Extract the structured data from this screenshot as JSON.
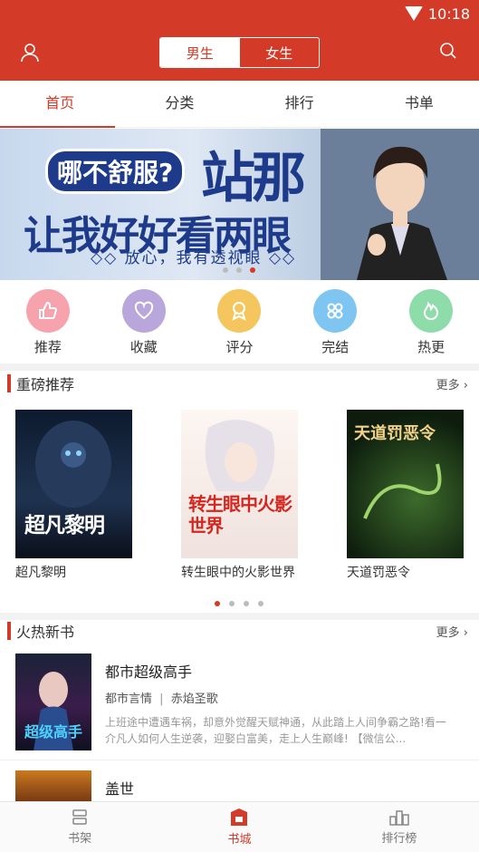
{
  "status": {
    "time": "10:18"
  },
  "header": {
    "gender_tabs": [
      "男生",
      "女生"
    ]
  },
  "tabs": [
    "首页",
    "分类",
    "排行",
    "书单"
  ],
  "banner": {
    "line1": "哪不舒服?",
    "big": "站那",
    "line2": "让我好好看两眼",
    "line3": "◇◇ 放心，我有透视眼 ◇◇"
  },
  "categories": [
    {
      "label": "推荐",
      "icon": "thumbs-up-icon",
      "color": "#f7a3ad"
    },
    {
      "label": "收藏",
      "icon": "heart-icon",
      "color": "#b9a6db"
    },
    {
      "label": "评分",
      "icon": "award-icon",
      "color": "#f5c55e"
    },
    {
      "label": "完结",
      "icon": "clover-icon",
      "color": "#7fc5f2"
    },
    {
      "label": "热更",
      "icon": "flame-icon",
      "color": "#8fdcab"
    }
  ],
  "featured": {
    "title": "重磅推荐",
    "more": "更多",
    "books": [
      {
        "title": "超凡黎明",
        "cover_text": "超凡黎明"
      },
      {
        "title": "转生眼中的火影世界",
        "cover_text": "转生眼中火影世界"
      },
      {
        "title": "天道罚恶令",
        "cover_text": "天道罚恶令"
      }
    ]
  },
  "hot_new": {
    "title": "火热新书",
    "more": "更多",
    "books": [
      {
        "title": "都市超级高手",
        "genre": "都市言情",
        "author": "赤焰圣歌",
        "desc": "上班途中遭遇车祸，却意外觉醒天赋神通，从此踏上人间争霸之路!看一介凡人如何人生逆袭，迎娶白富美，走上人生巅峰! 【微信公..."
      },
      {
        "title": "盖世"
      }
    ]
  },
  "bottom_nav": [
    {
      "label": "书架",
      "icon": "bookshelf-icon"
    },
    {
      "label": "书城",
      "icon": "store-icon"
    },
    {
      "label": "排行榜",
      "icon": "ranking-icon"
    }
  ]
}
